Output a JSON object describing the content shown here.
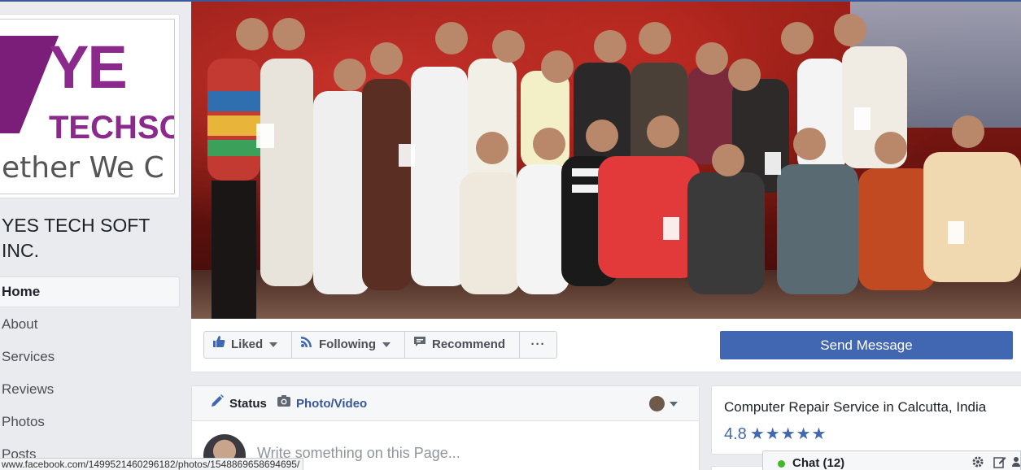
{
  "page": {
    "name": "YES TECH SOFT INC.",
    "logo": {
      "text_line1": "YE",
      "text_line2": "TECHSO",
      "tagline": "ether We C"
    }
  },
  "nav": {
    "items": [
      {
        "label": "Home",
        "active": true
      },
      {
        "label": "About",
        "active": false
      },
      {
        "label": "Services",
        "active": false
      },
      {
        "label": "Reviews",
        "active": false
      },
      {
        "label": "Photos",
        "active": false
      },
      {
        "label": "Posts",
        "active": false
      }
    ]
  },
  "actions": {
    "liked": "Liked",
    "following": "Following",
    "recommend": "Recommend",
    "more": "···",
    "send_message": "Send Message"
  },
  "composer": {
    "status_tab": "Status",
    "photo_tab": "Photo/Video",
    "placeholder": "Write something on this Page..."
  },
  "about": {
    "category": "Computer Repair Service in Calcutta, India",
    "rating": "4.8",
    "stars": "★★★★★"
  },
  "chat": {
    "label": "Chat (12)"
  },
  "statusbar": {
    "url": "www.facebook.com/1499521460296182/photos/1548869658694695/"
  },
  "colors": {
    "brand_blue": "#4267b2",
    "link_blue": "#365899",
    "logo_purple": "#8b2a8c",
    "online_green": "#42b72a"
  }
}
